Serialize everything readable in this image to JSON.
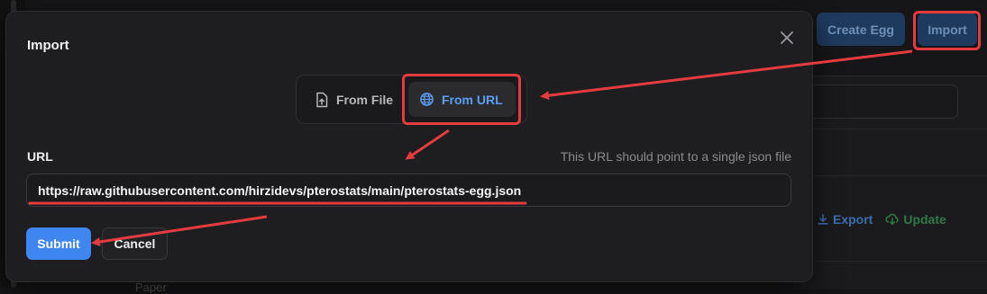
{
  "background": {
    "create_button": "Create Egg",
    "import_button": "Import",
    "export_action": "Export",
    "update_action": "Update",
    "partial_text": "Paper"
  },
  "modal": {
    "title": "Import",
    "close_icon": "close-icon",
    "tabs": [
      {
        "label": "From File",
        "icon": "file-upload-icon",
        "active": false
      },
      {
        "label": "From URL",
        "icon": "globe-icon",
        "active": true
      }
    ],
    "url_label": "URL",
    "url_hint": "This URL should point to a single json file",
    "url_value": "https://raw.githubusercontent.com/hirzidevs/pterostats/main/pterostats-egg.json",
    "submit_label": "Submit",
    "cancel_label": "Cancel"
  },
  "colors": {
    "accent": "#3f86f0",
    "highlight": "#e43b3f",
    "modal_bg": "#1e1e20",
    "page_bg": "#161618"
  }
}
